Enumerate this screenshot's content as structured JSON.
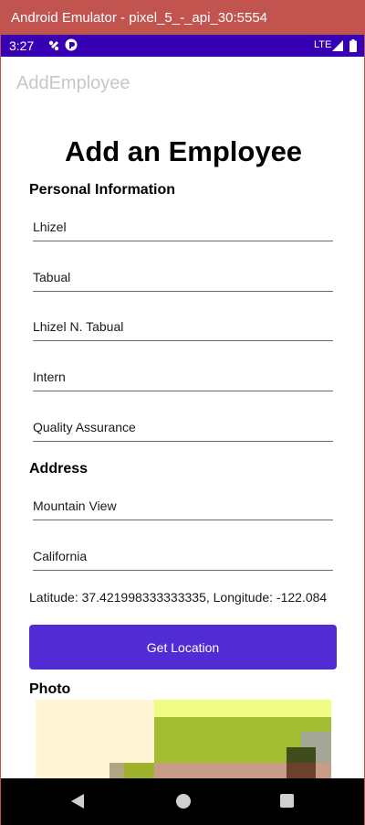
{
  "window": {
    "title": "Android Emulator - pixel_5_-_api_30:5554"
  },
  "status_bar": {
    "time": "3:27",
    "network": "LTE"
  },
  "app": {
    "title": "AddEmployee"
  },
  "page": {
    "heading": "Add an Employee"
  },
  "personal_info": {
    "label": "Personal Information",
    "fields": [
      "Lhizel",
      "Tabual",
      "Lhizel N. Tabual",
      "Intern",
      "Quality Assurance"
    ]
  },
  "address": {
    "label": "Address",
    "fields": [
      "Mountain View",
      "California"
    ],
    "coordinates": "Latitude: 37.421998333333335, Longitude: -122.084"
  },
  "actions": {
    "get_location": "Get Location"
  },
  "photo": {
    "label": "Photo"
  },
  "colors": {
    "accent": "#512bd4",
    "status_bar": "#3700b3",
    "window_title": "#c25450"
  },
  "icons": [
    "wifi-off-icon",
    "sync-icon",
    "signal-icon",
    "battery-icon",
    "back-icon",
    "home-icon",
    "recents-icon"
  ]
}
